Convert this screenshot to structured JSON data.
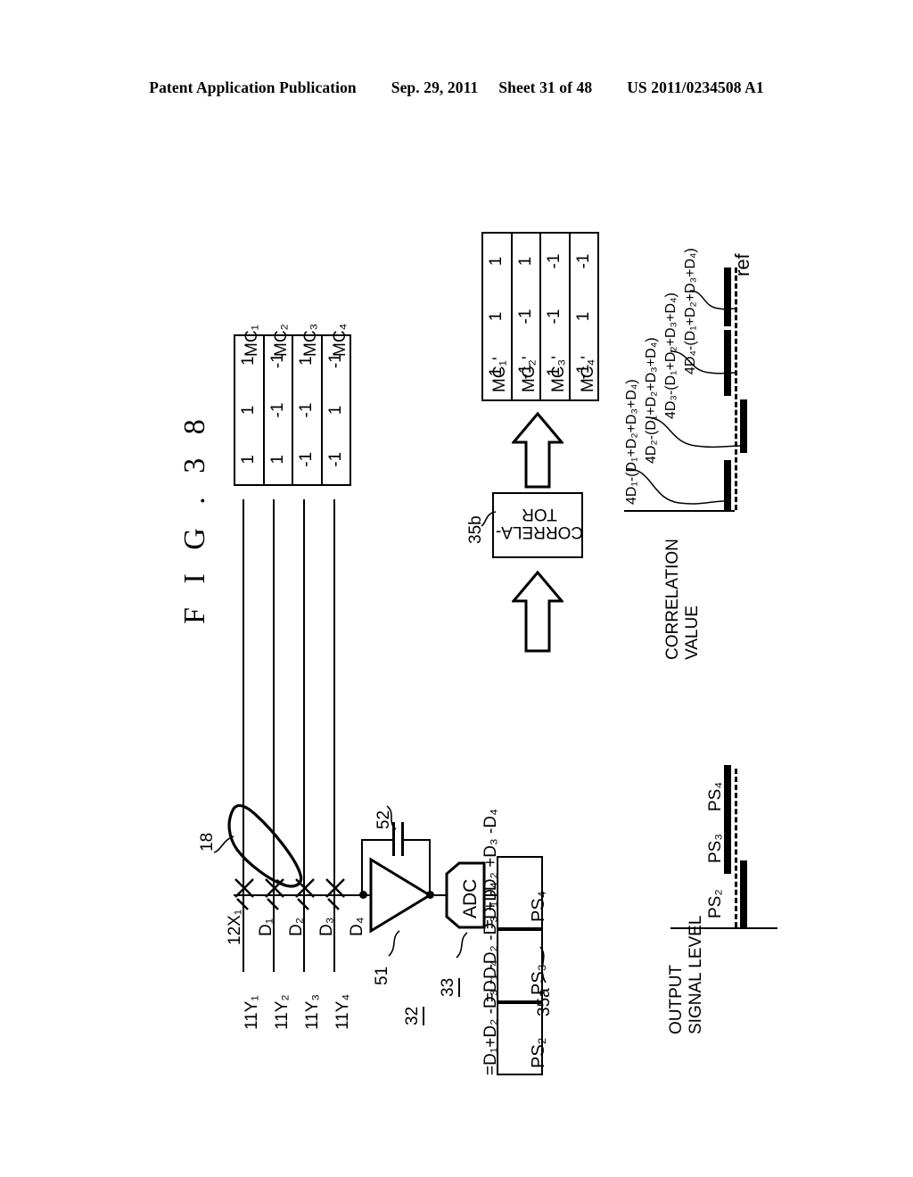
{
  "header": {
    "publication": "Patent Application Publication",
    "date": "Sep. 29, 2011",
    "sheet": "Sheet 31 of 48",
    "docnum": "US 2011/0234508 A1"
  },
  "figure": {
    "title": "F I G . 3 8"
  },
  "sensor": {
    "column_label": "12X₁",
    "finger_ref": "18",
    "row_labels": [
      "11Y₁",
      "11Y₂",
      "11Y₃",
      "11Y₄"
    ],
    "diode_labels": [
      "D₁",
      "D₂",
      "D₃",
      "D₄"
    ]
  },
  "frontend": {
    "amp_ref": "51",
    "cap_ref": "52",
    "block_ref": "32",
    "adc_label": "ADC",
    "adc_ref": "33"
  },
  "ps_block": {
    "ref": "35a",
    "rows": [
      {
        "name": "PS₄",
        "equation": "=D₁ -D₂ +D₃ -D₄"
      },
      {
        "name": "PS₃",
        "equation": "=D₁ -D₂ -D₃ +D₄"
      },
      {
        "name": "PS₂",
        "equation": "=D₁+D₂ -D₃ -D₄"
      }
    ]
  },
  "mc_table": {
    "row_labels": [
      "MC₁",
      "MC₂",
      "MC₃",
      "MC₄"
    ],
    "values": [
      [
        "1",
        "1",
        "1"
      ],
      [
        "1",
        "-1",
        "-1"
      ],
      [
        "-1",
        "-1",
        "1"
      ],
      [
        "-1",
        "1",
        "-1"
      ]
    ]
  },
  "mc_prime_table": {
    "row_labels": [
      "MC₁'",
      "MC₂'",
      "MC₃'",
      "MC₄'"
    ],
    "values": [
      [
        "1",
        "1",
        "1"
      ],
      [
        "-1",
        "-1",
        "1"
      ],
      [
        "1",
        "-1",
        "-1"
      ],
      [
        "-1",
        "1",
        "-1"
      ]
    ]
  },
  "correlator": {
    "line1": "CORRELA-",
    "line2": "TOR",
    "ref": "35b"
  },
  "output_chart": {
    "axis_label_line1": "OUTPUT",
    "axis_label_line2": "SIGNAL LEVEL",
    "bars": [
      {
        "label": "PS₂",
        "direction": "positive"
      },
      {
        "label": "PS₃",
        "direction": "negative"
      },
      {
        "label": "PS₄",
        "direction": "negative"
      }
    ]
  },
  "correlation_chart": {
    "axis_label_line1": "CORRELATION",
    "axis_label_line2": "VALUE",
    "ref_label": "ref",
    "bars": [
      {
        "formula": "4D₁-(D₁+D₂+D₃+D₄)",
        "direction": "negative"
      },
      {
        "formula": "4D₂-(D₁+D₂+D₃+D₄)",
        "direction": "positive"
      },
      {
        "formula": "4D₃-(D₁+D₂+D₃+D₄)",
        "direction": "negative"
      },
      {
        "formula": "4D₄-(D₁+D₂+D₃+D₄)",
        "direction": "negative"
      }
    ]
  }
}
